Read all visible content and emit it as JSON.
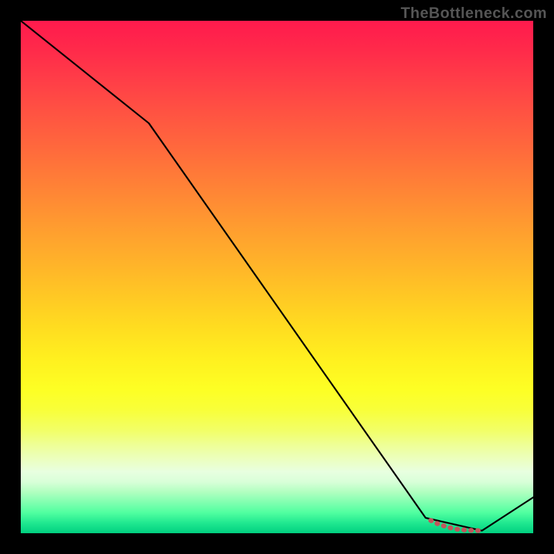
{
  "watermark": "TheBottleneck.com",
  "colors": {
    "background": "#000000",
    "line": "#000000",
    "marker": "#c1565c",
    "gradient_top": "#ff1a4d",
    "gradient_bottom": "#00d080"
  },
  "chart_data": {
    "type": "line",
    "title": "",
    "xlabel": "",
    "ylabel": "",
    "xlim": [
      0,
      100
    ],
    "ylim": [
      0,
      100
    ],
    "x": [
      0,
      25,
      79,
      90,
      100
    ],
    "values": [
      100,
      80,
      3,
      0.5,
      7
    ],
    "highlight_points": {
      "type": "optimal_zone",
      "x": [
        80,
        81,
        82,
        83,
        84,
        85,
        86,
        87,
        88,
        89,
        90
      ],
      "y": [
        2.5,
        2.0,
        1.6,
        1.3,
        1.0,
        0.8,
        0.7,
        0.6,
        0.55,
        0.52,
        0.5
      ]
    }
  }
}
